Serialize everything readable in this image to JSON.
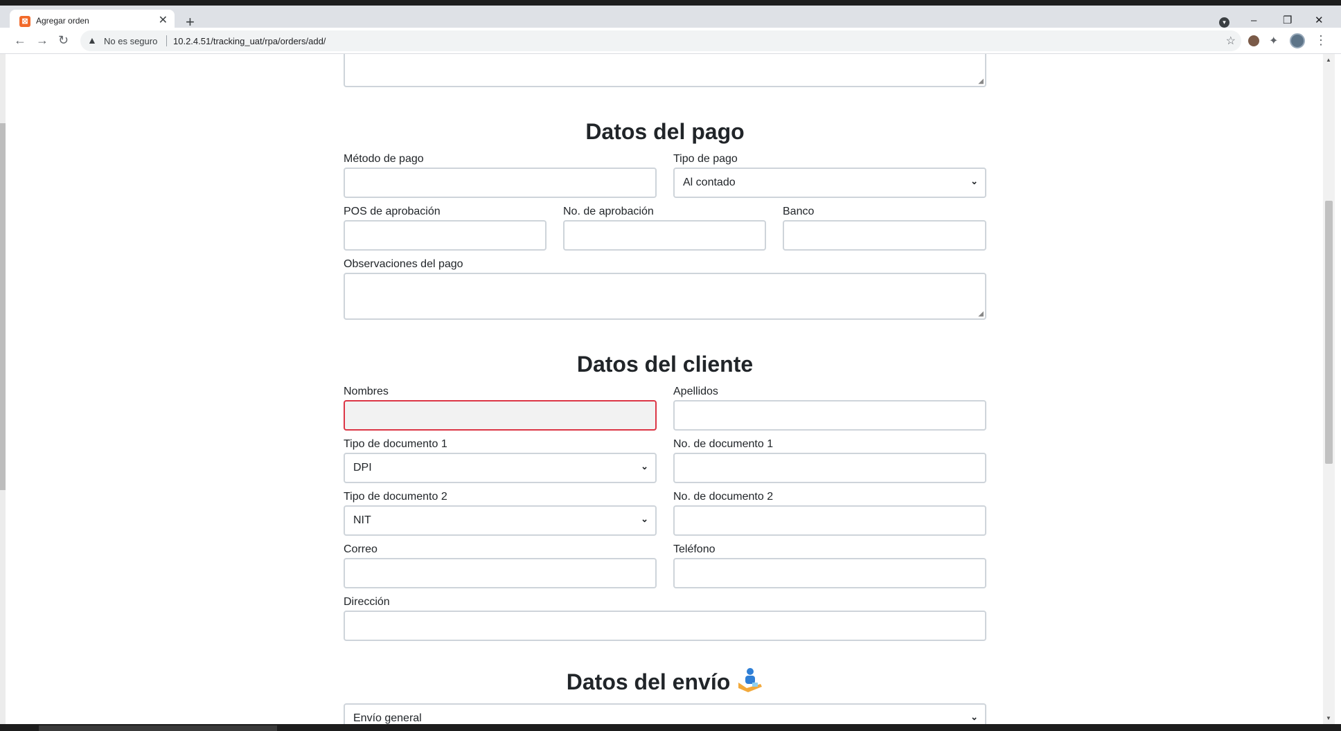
{
  "browser": {
    "tab_title": "Agregar orden",
    "tab_close": "✕",
    "new_tab": "+",
    "security_label": "No es seguro",
    "url": "10.2.4.51/tracking_uat/rpa/orders/add/",
    "window_controls": [
      "–",
      "❐",
      "✕"
    ]
  },
  "form": {
    "payment": {
      "heading": "Datos del pago",
      "metodo_label": "Método de pago",
      "metodo_value": "",
      "tipo_label": "Tipo de pago",
      "tipo_value": "Al contado",
      "pos_label": "POS de aprobación",
      "aprobacion_label": "No. de aprobación",
      "banco_label": "Banco",
      "observaciones_label": "Observaciones del pago"
    },
    "client": {
      "heading": "Datos del cliente",
      "nombres_label": "Nombres",
      "apellidos_label": "Apellidos",
      "tipo_doc1_label": "Tipo de documento 1",
      "tipo_doc1_value": "DPI",
      "no_doc1_label": "No. de documento 1",
      "tipo_doc2_label": "Tipo de documento 2",
      "tipo_doc2_value": "NIT",
      "no_doc2_label": "No. de documento 2",
      "correo_label": "Correo",
      "telefono_label": "Teléfono",
      "direccion_label": "Dirección"
    },
    "shipping": {
      "heading": "Datos del envío",
      "tipo_envio_value": "Envío general"
    }
  },
  "icons": {
    "favicon": "xampp-icon",
    "warning": "warning-icon",
    "delivery": "delivery-hand-icon"
  }
}
